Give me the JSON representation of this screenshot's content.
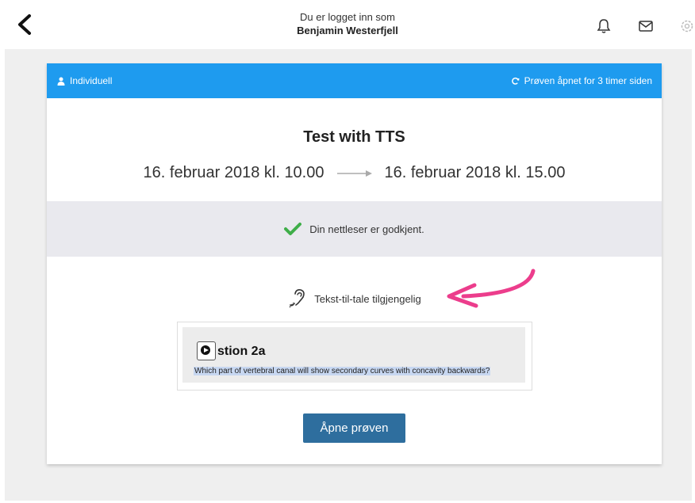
{
  "header": {
    "logged_in_as": "Du er logget inn som",
    "user_name": "Benjamin Westerfjell",
    "icons": [
      "back-chevron-icon",
      "bell-icon",
      "mail-icon",
      "gear-icon"
    ]
  },
  "card": {
    "mode_label": "Individuell",
    "opened_label": "Prøven åpnet for 3 timer siden",
    "title": "Test with TTS",
    "start_date": "16. februar 2018 kl. 10.00",
    "end_date": "16. februar 2018 kl. 15.00",
    "browser_status": "Din nettleser er godkjent.",
    "tts_label": "Tekst-til-tale tilgjengelig",
    "question_title_visible": "stion 2a",
    "question_text": "Which part of vertebral canal will show secondary curves with concavity backwards?",
    "open_button": "Åpne prøven"
  },
  "colors": {
    "header_blue": "#1e9bef",
    "button_blue": "#2e6e9e",
    "check_green": "#3fae49",
    "arrow_pink": "#ec3d8c",
    "highlight": "#c7d7f1"
  }
}
